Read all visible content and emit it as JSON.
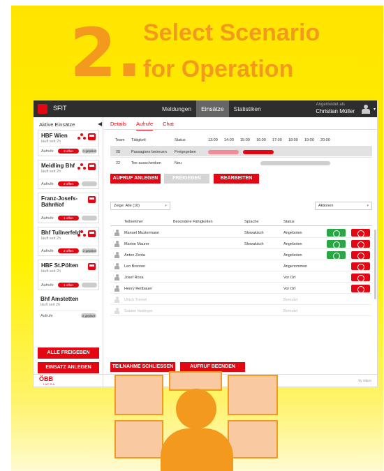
{
  "poster": {
    "step_number": "2.",
    "title_line1": "Select Scenario",
    "title_line2": "for Operation"
  },
  "app": {
    "name": "SFIT",
    "logo_letter": "■",
    "nav": [
      "Meldungen",
      "Einsätze",
      "Statistiken"
    ],
    "nav_active": "Einsätze",
    "user_label": "Angemeldet als",
    "user_name": "Christian Müller",
    "user_caret": "▾"
  },
  "sidebar": {
    "title": "Aktive Einsätze",
    "collapse_icon": "◀",
    "cards": [
      {
        "name": "HBF Wien",
        "sub": "läuft seit 2h",
        "foot_label": "Aufrufe",
        "red_pill": "3 offen",
        "gray_pill": "1 geplant"
      },
      {
        "name": "Meidling Bhf",
        "sub": "läuft seit 2h",
        "foot_label": "Aufrufe",
        "red_pill": "2 offen",
        "gray_pill": ""
      },
      {
        "name": "Franz-Josefs-Bahnhof",
        "sub": "läuft seit 2h",
        "foot_label": "Aufrufe",
        "red_pill": "1 offen",
        "gray_pill": ""
      },
      {
        "name": "Bhf Tullnerfeld",
        "sub": "läuft seit 2h",
        "foot_label": "Aufrufe",
        "red_pill": "2 offen",
        "gray_pill": "2 geplant"
      },
      {
        "name": "HBF St.Pölten",
        "sub": "läuft seit 2h",
        "foot_label": "Aufrufe",
        "red_pill": "1 offen",
        "gray_pill": ""
      },
      {
        "name": "Bhf Amstetten",
        "sub": "läuft seit 2h",
        "foot_label": "Aufrufe",
        "red_pill": "",
        "gray_pill": "2 geplant"
      }
    ],
    "btn_release_all": "ALLE FREIGEBEN",
    "btn_new_operation": "EINSATZ ANLEGEN"
  },
  "main": {
    "tabs": [
      "Details",
      "Aufrufe",
      "Chat"
    ],
    "active_tab": "Aufrufe",
    "gantt_headers": {
      "team": "Team",
      "activity": "Tätigkeit",
      "status": "Status",
      "hours": [
        "13:00",
        "14:00",
        "15:00",
        "16:00",
        "17:00",
        "18:00",
        "19:00",
        "20:00"
      ]
    },
    "gantt_rows": [
      {
        "team": "20",
        "activity": "Passagiere betreuen",
        "status": "Freigegeben"
      },
      {
        "team": "22",
        "activity": "Tee ausschenken",
        "status": "Neu"
      }
    ],
    "btn_create_call": "AUFRUF ANLEGEN",
    "btn_release": "FREIGEBEN",
    "btn_edit": "BEARBEITEN",
    "filter_label": "Zeige: Alle (16)",
    "actions_label": "Aktionen",
    "table_headers": [
      "Teilnehmer",
      "Besondere Fähigkeiten",
      "Sprache",
      "Status"
    ],
    "participants": [
      {
        "name": "Manuel Mustermann",
        "skill": "",
        "language": "Slowakisch",
        "status": "Angeboten",
        "ok": true,
        "x": true
      },
      {
        "name": "Marion Maurer",
        "skill": "",
        "language": "Slowakisch",
        "status": "Angeboten",
        "ok": true,
        "x": true
      },
      {
        "name": "Anton Zenta",
        "skill": "",
        "language": "",
        "status": "Angeboten",
        "ok": true,
        "x": true
      },
      {
        "name": "Leo Brenner",
        "skill": "",
        "language": "",
        "status": "Angenommen",
        "ok": false,
        "x": true
      },
      {
        "name": "Josef Rosa",
        "skill": "",
        "language": "",
        "status": "Vor Ort",
        "ok": false,
        "x": true
      },
      {
        "name": "Henry Reitbauer",
        "skill": "",
        "language": "",
        "status": "Vor Ort",
        "ok": false,
        "x": true
      },
      {
        "name": "Ulrich Tremel",
        "skill": "",
        "language": "",
        "status": "Beendet",
        "ok": false,
        "x": false
      },
      {
        "name": "Sabine Hettinger",
        "skill": "",
        "language": "",
        "status": "Beendet",
        "ok": false,
        "x": false
      }
    ],
    "btn_close_participation": "TEILNAHME SCHLIESSEN",
    "btn_end_call": "AUFRUF BEENDEN"
  },
  "footer": {
    "brand": "ÖBB",
    "brand_sub": "INFRA",
    "credit": "by siquo"
  },
  "colors": {
    "accent": "#e30613",
    "poster_yellow": "#fff200",
    "poster_orange": "#f39a1e",
    "ok_green": "#29a744"
  }
}
